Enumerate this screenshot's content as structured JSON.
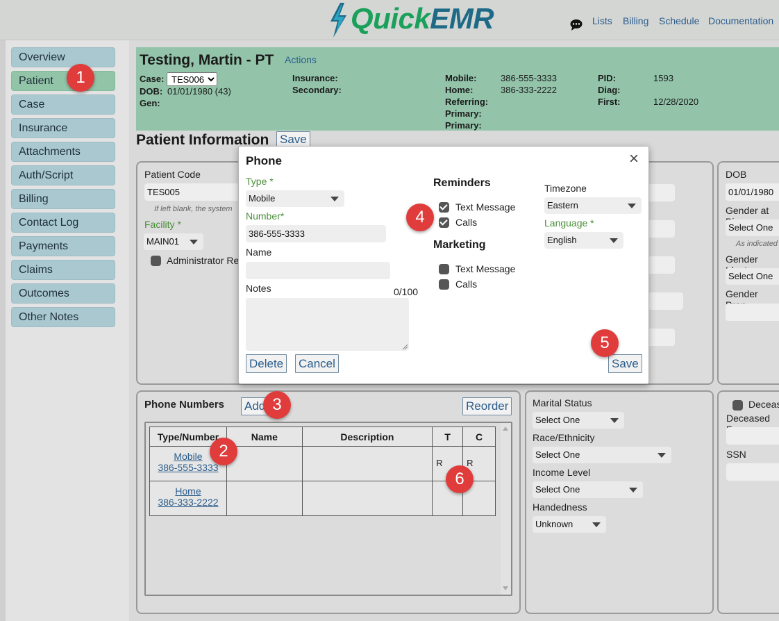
{
  "app": {
    "logo_quick": "Quick",
    "logo_emr": "EMR"
  },
  "nav": {
    "lists": "Lists",
    "billing": "Billing",
    "schedule": "Schedule",
    "documentation": "Documentation"
  },
  "sidebar": {
    "items": [
      "Overview",
      "Patient",
      "Case",
      "Insurance",
      "Attachments",
      "Auth/Script",
      "Billing",
      "Contact Log",
      "Payments",
      "Claims",
      "Outcomes",
      "Other Notes"
    ],
    "active": "Patient"
  },
  "header": {
    "patient_name": "Testing, Martin - PT",
    "actions": "Actions",
    "case_label": "Case:",
    "case_value": "TES006",
    "dob_label": "DOB:",
    "dob_value": "01/01/1980 (43)",
    "gen_label": "Gen:",
    "insurance_label": "Insurance:",
    "secondary_label": "Secondary:",
    "mobile_label": "Mobile:",
    "mobile_value": "386-555-3333",
    "home_label": "Home:",
    "home_value": "386-333-2222",
    "referring_label": "Referring:",
    "primary_label": "Primary:",
    "primary2_label": "Primary:",
    "pid_label": "PID:",
    "pid_value": "1593",
    "diag_label": "Diag:",
    "first_label": "First:",
    "first_value": "12/28/2020"
  },
  "patient_info": {
    "title": "Patient Information",
    "save": "Save",
    "patient_code_label": "Patient Code",
    "patient_code_value": "TES005",
    "hint": "If left blank, the system",
    "facility_label": "Facility *",
    "facility_value": "MAIN01",
    "admin_label": "Administrator Re",
    "dob_label": "DOB",
    "dob_value": "01/01/1980",
    "gender_birth_label": "Gender at Bi",
    "gender_birth_value": "Select One",
    "as_indicated": "As indicated",
    "gender_ident_label": "Gender Ident",
    "gender_ident_value": "Select One",
    "gender_pron_label": "Gender Pron"
  },
  "phone_numbers": {
    "title": "Phone Numbers",
    "add": "Add",
    "reorder": "Reorder",
    "columns": [
      "Type/Number",
      "Name",
      "Description",
      "T",
      "C"
    ],
    "rows": [
      {
        "type": "Mobile",
        "number": "386-555-3333",
        "t": "R",
        "c": "R"
      },
      {
        "type": "Home",
        "number": "386-333-2222",
        "t": "",
        "c": ""
      }
    ]
  },
  "demographics": {
    "marital_label": "Marital Status",
    "marital_value": "Select One",
    "race_label": "Race/Ethnicity",
    "race_value": "Select One",
    "income_label": "Income Level",
    "income_value": "Select One",
    "hand_label": "Handedness",
    "hand_value": "Unknown"
  },
  "deceased": {
    "deceased_label": "Deceas",
    "deceased_date_label": "Deceased Da",
    "ssn_label": "SSN"
  },
  "modal": {
    "title": "Phone",
    "type_label": "Type *",
    "type_value": "Mobile",
    "number_label": "Number*",
    "number_value": "386-555-3333",
    "name_label": "Name",
    "name_value": "",
    "notes_label": "Notes",
    "notes_count": "0/100",
    "reminders_title": "Reminders",
    "rem_text": "Text Message",
    "rem_calls": "Calls",
    "marketing_title": "Marketing",
    "mkt_text": "Text Message",
    "mkt_calls": "Calls",
    "timezone_label": "Timezone",
    "timezone_value": "Eastern",
    "language_label": "Language *",
    "language_value": "English",
    "delete": "Delete",
    "cancel": "Cancel",
    "save": "Save",
    "close": "×"
  },
  "badges": [
    "1",
    "2",
    "3",
    "4",
    "5",
    "6"
  ],
  "icons": {
    "chat": "chat-bubble-icon",
    "close": "close-icon"
  },
  "colors": {
    "header_bg": "#93c4aa",
    "nav_btn": "#a9c8d0",
    "active_btn": "#92c4a8",
    "badge": "#e03c3c",
    "link": "#2b5d8c",
    "label_green": "#4b8f3a"
  }
}
